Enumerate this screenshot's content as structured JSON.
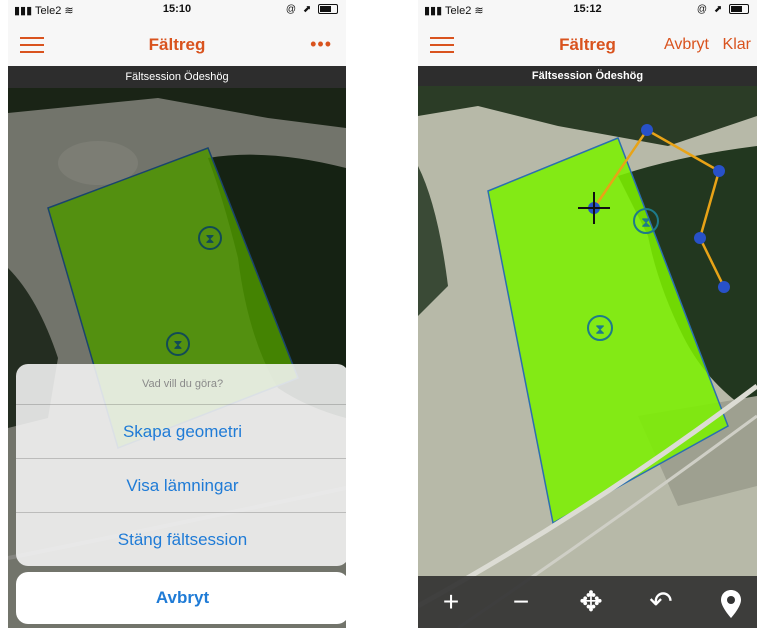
{
  "left_screen": {
    "status": {
      "carrier": "Tele2",
      "time": "15:10",
      "icons": "@ ⬈"
    },
    "nav": {
      "title": "Fältreg",
      "menu_icon": "hamburger-icon",
      "more_icon": "more-dots-icon",
      "more_text": "•••"
    },
    "session_title": "Fältsession Ödeshög",
    "action_sheet": {
      "title": "Vad vill du göra?",
      "options": [
        "Skapa geometri",
        "Visa lämningar",
        "Stäng fältsession"
      ],
      "cancel": "Avbryt"
    }
  },
  "right_screen": {
    "status": {
      "carrier": "Tele2",
      "time": "15:12",
      "icons": "@ ⬈"
    },
    "nav": {
      "title": "Fältreg",
      "cancel": "Avbryt",
      "done": "Klar",
      "menu_icon": "hamburger-icon"
    },
    "session_title": "Fältsession Ödeshög",
    "toolbar": {
      "items": [
        {
          "name": "zoom-in-icon",
          "glyph": "+"
        },
        {
          "name": "zoom-out-icon",
          "glyph": "−"
        },
        {
          "name": "move-icon",
          "glyph": "✥"
        },
        {
          "name": "undo-icon",
          "glyph": "↶"
        },
        {
          "name": "pin-icon",
          "glyph": "⬤"
        }
      ]
    }
  },
  "colors": {
    "accent": "#d9531e",
    "ios_blue": "#1f7bd6",
    "polygon_fill": "#7cf000",
    "polygon_stroke": "#2b6fb0",
    "vertex": "#2851c8",
    "line_draft": "#e8a317",
    "forest": "#1e3a1c",
    "field": "#b7b9a8"
  }
}
